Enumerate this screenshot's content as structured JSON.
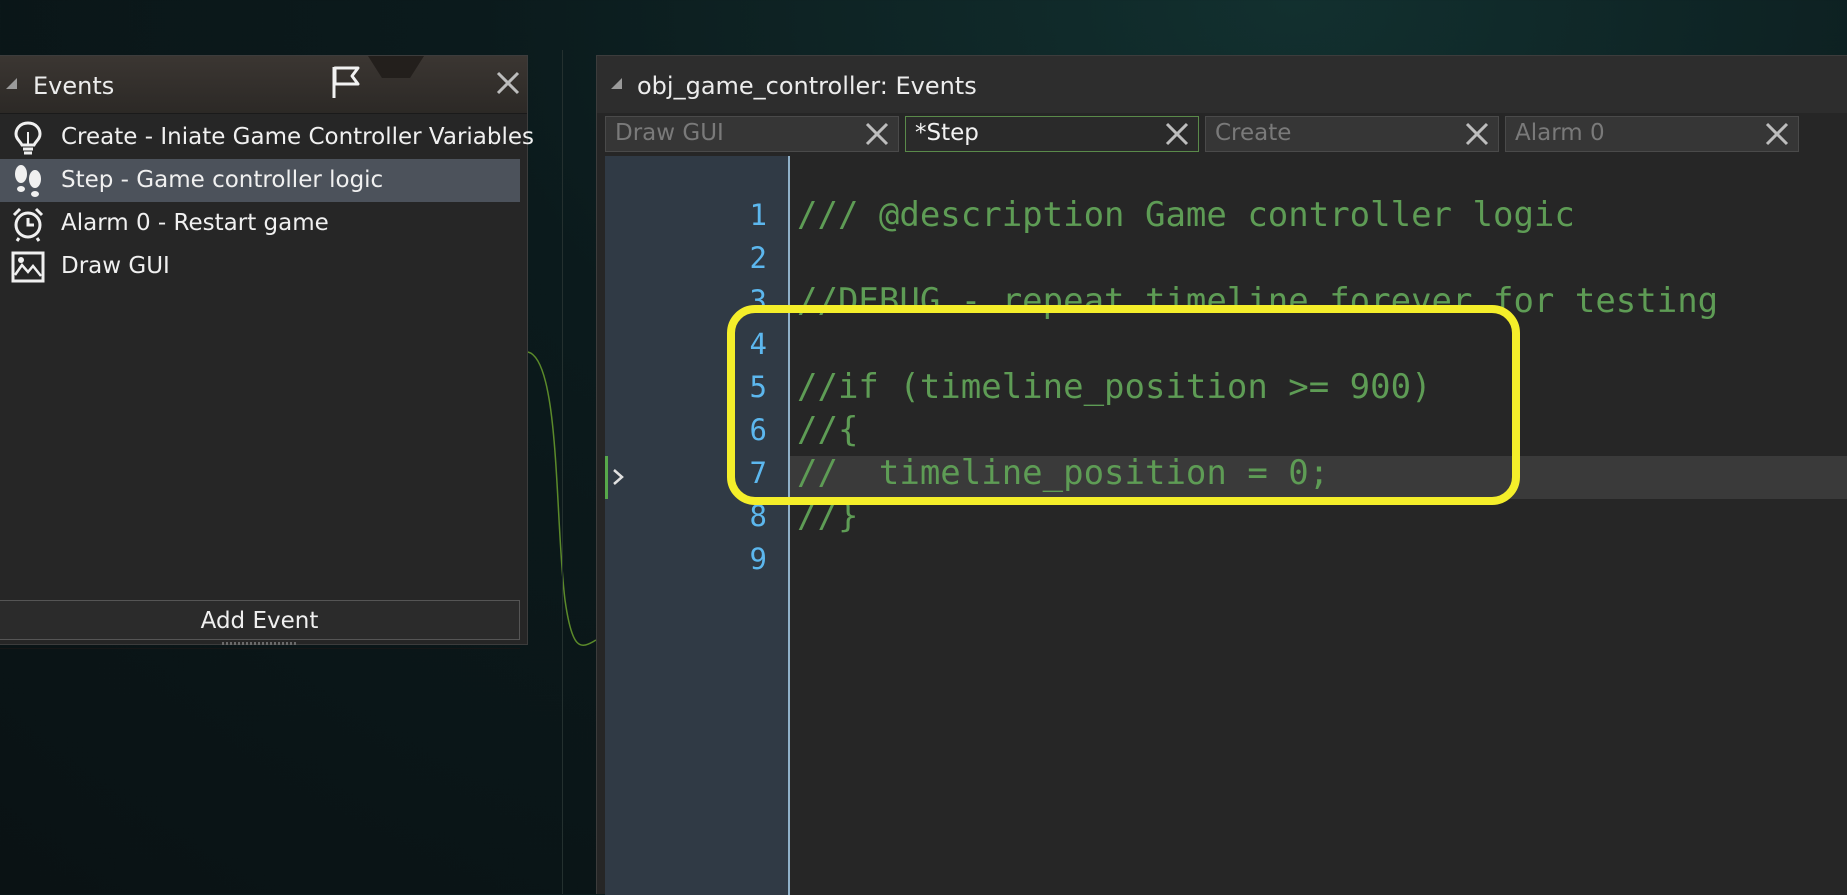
{
  "events_panel": {
    "title": "Events",
    "items": [
      {
        "label": "Create - Iniate Game Controller Variables",
        "icon": "lightbulb-icon"
      },
      {
        "label": "Step - Game controller logic",
        "icon": "footsteps-icon",
        "selected": true
      },
      {
        "label": "Alarm 0 - Restart game",
        "icon": "alarm-clock-icon"
      },
      {
        "label": "Draw GUI",
        "icon": "image-icon"
      }
    ],
    "add_event_label": "Add Event"
  },
  "editor": {
    "title": "obj_game_controller: Events",
    "tabs": [
      {
        "label": "Draw GUI",
        "active": false
      },
      {
        "label": "*Step",
        "active": true
      },
      {
        "label": "Create",
        "active": false
      },
      {
        "label": "Alarm 0",
        "active": false
      }
    ],
    "lines": [
      {
        "no": "1",
        "text": "/// @description Game controller logic"
      },
      {
        "no": "2",
        "text": ""
      },
      {
        "no": "3",
        "text": "//DEBUG - repeat timeline forever for testing"
      },
      {
        "no": "4",
        "text": ""
      },
      {
        "no": "5",
        "text": "//if (timeline_position >= 900)"
      },
      {
        "no": "6",
        "text": "//{"
      },
      {
        "no": "7",
        "text": "//  timeline_position = 0;"
      },
      {
        "no": "8",
        "text": "//}"
      },
      {
        "no": "9",
        "text": ""
      }
    ],
    "current_line": 8
  },
  "colors": {
    "highlight": "#f4ee2a",
    "code_comment": "#5e9c55",
    "line_number": "#5cb7ee",
    "selected_item": "#4c525b"
  }
}
